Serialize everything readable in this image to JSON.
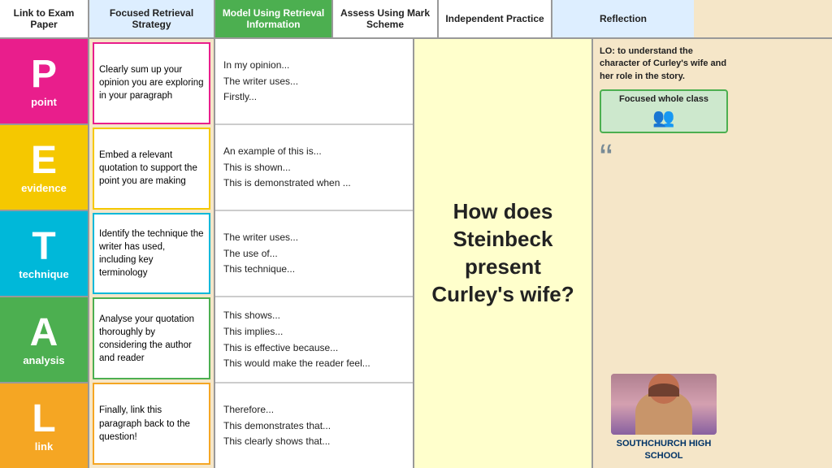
{
  "header": {
    "link_label": "Link to Exam Paper",
    "focused_label": "Focused Retrieval Strategy",
    "model_label": "Model Using Retrieval Information",
    "assess_label": "Assess Using Mark Scheme",
    "independent_label": "Independent Practice",
    "reflection_label": "Reflection"
  },
  "letters": [
    {
      "letter": "P",
      "label": "point",
      "color_class": "lb-pink"
    },
    {
      "letter": "E",
      "label": "evidence",
      "color_class": "lb-yellow"
    },
    {
      "letter": "T",
      "label": "technique",
      "color_class": "lb-cyan"
    },
    {
      "letter": "A",
      "label": "analysis",
      "color_class": "lb-green"
    },
    {
      "letter": "L",
      "label": "link",
      "color_class": "lb-orange"
    }
  ],
  "descriptions": [
    {
      "text": "Clearly sum up your opinion you are exploring in your paragraph",
      "border": "pink"
    },
    {
      "text": "Embed a relevant quotation to support the point you are making",
      "border": "yellow"
    },
    {
      "text": "Identify the technique the writer has used, including key terminology",
      "border": "cyan"
    },
    {
      "text": "Analyse your quotation thoroughly by considering the author and reader",
      "border": "green"
    },
    {
      "text": "Finally, link this paragraph back to the question!",
      "border": "orange"
    }
  ],
  "phrases": [
    {
      "items": [
        "In my opinion...",
        "The writer uses...",
        "Firstly..."
      ]
    },
    {
      "items": [
        "An example of this is...",
        "This is shown...",
        "This is demonstrated when ..."
      ]
    },
    {
      "items": [
        "The writer uses...",
        "The use of...",
        "This technique..."
      ]
    },
    {
      "items": [
        "This shows...",
        "This implies...",
        "This is effective because...",
        "This would make the reader feel..."
      ]
    },
    {
      "items": [
        "Therefore...",
        "This demonstrates that...",
        "This clearly shows that..."
      ]
    }
  ],
  "question": {
    "text": "How does Steinbeck present Curley's wife?"
  },
  "reflection": {
    "lo_bold": "LO:",
    "lo_text": " to understand the character of Curley's wife and her role in the story.",
    "focused_label": "Focused whole class",
    "school_name": "SOUTHCHURCH HIGH SCHOOL"
  }
}
